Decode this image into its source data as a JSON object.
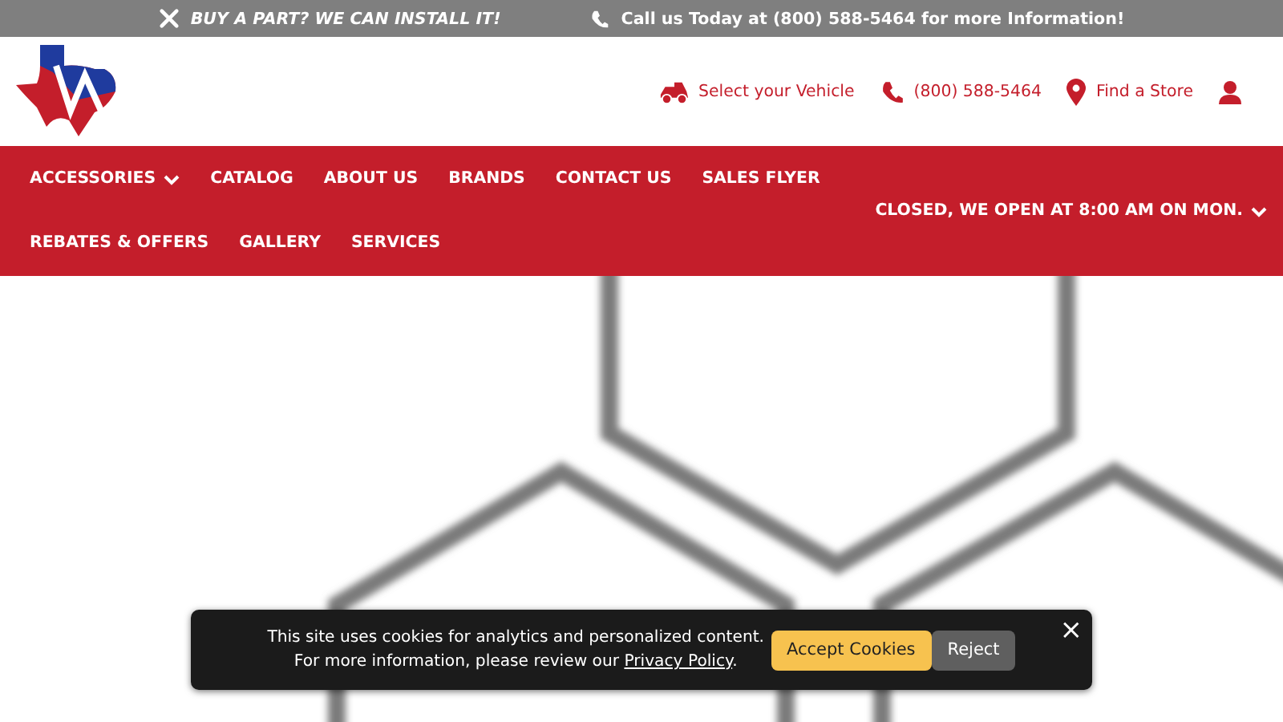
{
  "top_bar": {
    "promo": "BUY A PART? WE CAN INSTALL IT!",
    "call": "Call us Today at (800) 588-5464 for more Information!"
  },
  "header": {
    "links": [
      {
        "kind": "vehicle",
        "label": "Select your Vehicle"
      },
      {
        "kind": "phone",
        "label": "(800) 588-5464"
      },
      {
        "kind": "store",
        "label": "Find a Store"
      },
      {
        "kind": "account"
      }
    ]
  },
  "nav": {
    "items": [
      {
        "label": "ACCESSORIES",
        "dropdown": true
      },
      {
        "label": "CATALOG",
        "dropdown": false
      },
      {
        "label": "ABOUT US",
        "dropdown": false
      },
      {
        "label": "BRANDS",
        "dropdown": false
      },
      {
        "label": "CONTACT US",
        "dropdown": false
      },
      {
        "label": "SALES FLYER",
        "dropdown": false
      },
      {
        "label": "REBATES & OFFERS",
        "dropdown": false
      },
      {
        "label": "GALLERY",
        "dropdown": false
      },
      {
        "label": "SERVICES",
        "dropdown": false
      }
    ],
    "hours": {
      "label": "CLOSED, WE OPEN AT 8:00 AM ON MON.",
      "dropdown": true
    }
  },
  "cookie_banner": {
    "line_1": "This site uses cookies for analytics and personalized content.",
    "line_2": "For more information, please review our",
    "link": "Privacy Policy",
    "line_end": ".",
    "accept": "Accept Cookies",
    "reject": "Reject",
    "close": "×"
  }
}
